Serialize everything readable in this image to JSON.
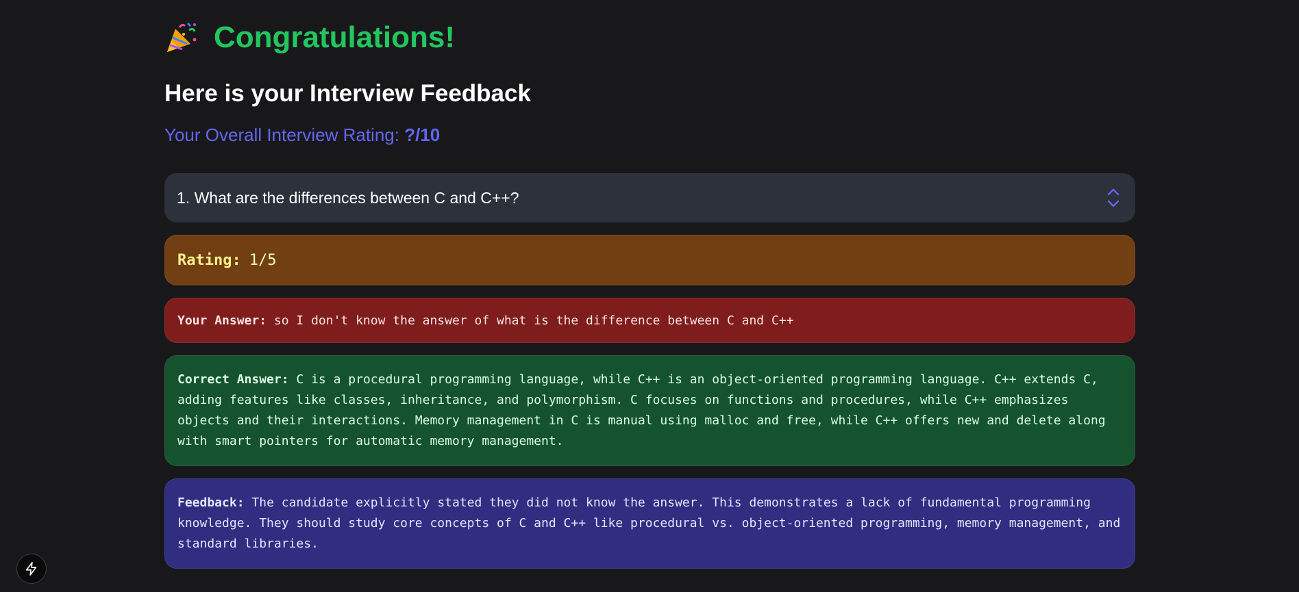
{
  "header": {
    "icon": "party-popper-icon",
    "title": "Congratulations!",
    "subtitle": "Here is your Interview Feedback",
    "overall_label": "Your Overall Interview Rating:",
    "overall_value": "?/10"
  },
  "question": {
    "text": "1. What are the differences between C and C++?",
    "toggle_icon": "chevron-up-down-icon"
  },
  "rating": {
    "label": "Rating:",
    "value": "1/5"
  },
  "your_answer": {
    "label": "Your Answer:",
    "text": "so I don't know the answer of what is the difference between C and C++"
  },
  "correct_answer": {
    "label": "Correct Answer:",
    "text": "C is a procedural programming language, while C++ is an object-oriented programming language. C++ extends C, adding features like classes, inheritance, and polymorphism. C focuses on functions and procedures, while C++ emphasizes objects and their interactions. Memory management in C is manual using malloc and free, while C++ offers new and delete along with smart pointers for automatic memory management."
  },
  "feedback": {
    "label": "Feedback:",
    "text": "The candidate explicitly stated they did not know the answer. This demonstrates a lack of fundamental programming knowledge. They should study core concepts of C and C++ like procedural vs. object-oriented programming, memory management, and standard libraries."
  },
  "dev_tools": {
    "icon": "lightning-bolt-icon"
  },
  "colors": {
    "background": "#18181b",
    "title": "#22c55e",
    "overall": "#6366f1",
    "question_bg": "#2c313b",
    "rating_bg": "#713f12",
    "answer_bg": "#7f1d1d",
    "correct_bg": "#14532d",
    "feedback_bg": "#312e81"
  }
}
